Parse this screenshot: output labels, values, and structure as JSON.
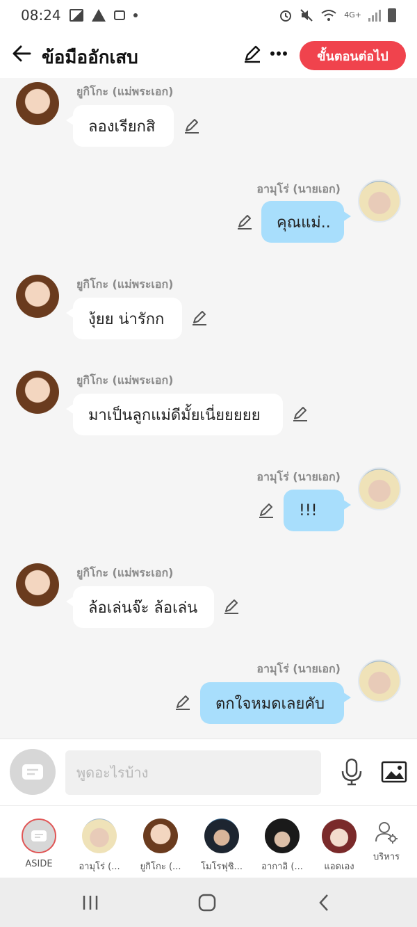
{
  "status": {
    "time": "08:24",
    "network": "4G+"
  },
  "header": {
    "title": "ข้อมืออักเสบ",
    "next_label": "ขั้นตอนต่อไป"
  },
  "messages": [
    {
      "side": "left",
      "sender": "ยูกิโกะ (แม่พระเอก)",
      "text": "ลองเรียกสิ"
    },
    {
      "side": "right",
      "sender": "อามุโร่ (นายเอก)",
      "text": "คุณแม่.."
    },
    {
      "side": "left",
      "sender": "ยูกิโกะ (แม่พระเอก)",
      "text": "งุ้ยย น่ารักก"
    },
    {
      "side": "left",
      "sender": "ยูกิโกะ (แม่พระเอก)",
      "text": "มาเป็นลูกแม่ดีมั้ยเนี่ยยยยย"
    },
    {
      "side": "right",
      "sender": "อามุโร่ (นายเอก)",
      "text": "!!!"
    },
    {
      "side": "left",
      "sender": "ยูกิโกะ (แม่พระเอก)",
      "text": "ล้อเล่นจ๊ะ ล้อเล่น"
    },
    {
      "side": "right",
      "sender": "อามุโร่ (นายเอก)",
      "text": "ตกใจหมดเลยคับ"
    }
  ],
  "input": {
    "placeholder": "พูดอะไรบ้าง"
  },
  "characters": [
    {
      "name": "ASIDE"
    },
    {
      "name": "อามุโร่ (..."
    },
    {
      "name": "ยูกิโกะ (..."
    },
    {
      "name": "โมโรฟุชิ..."
    },
    {
      "name": "อากาอิ (..."
    },
    {
      "name": "แอดเอง"
    }
  ],
  "manage_label": "บริหาร",
  "colors": {
    "accent": "#f0434d",
    "bubble_right": "#a8defc",
    "bubble_left": "#ffffff"
  }
}
